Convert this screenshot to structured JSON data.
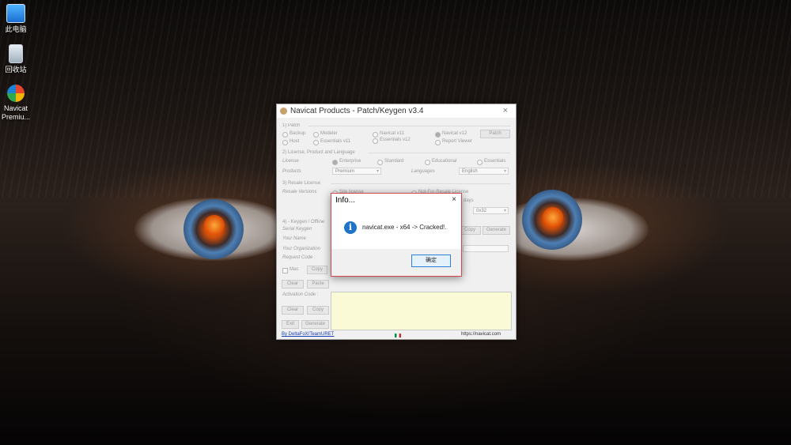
{
  "desktop": {
    "icons": [
      {
        "label": "此电脑",
        "icon": "computer-icon"
      },
      {
        "label": "回收站",
        "icon": "recycle-bin-icon"
      },
      {
        "label": "Navicat Premiu...",
        "icon": "navicat-icon"
      }
    ]
  },
  "patch_window": {
    "title": "Navicat Products - Patch/Keygen v3.4",
    "close_symbol": "×",
    "patch": {
      "heading": "1) Patch",
      "options": [
        "Backup",
        "Modeler",
        "Navicat v11",
        "Navicat v12",
        "Host",
        "Essentials v11",
        "Essentials v12",
        "Report Viewer"
      ],
      "patch_button": "Patch"
    },
    "license": {
      "heading": "2) License, Product and Language",
      "license_label": "License",
      "license_options": [
        "Enterprise",
        "Standard",
        "Educational",
        "Essentials"
      ],
      "products_label": "Products",
      "products_value": "Premium",
      "languages_label": "Languages",
      "languages_value": "English"
    },
    "resale": {
      "heading": "3) Resale License",
      "resale_versions_label": "Resale Versions",
      "site_license": "Site license",
      "not_for_resale": "Not-For-Resale License",
      "days_label": "days",
      "version_value": "0x32"
    },
    "keygen": {
      "heading": "4) - Keygen / Offline",
      "serial_label": "Serial Keygen",
      "name_label": "Your Name",
      "org_label": "Your Organization",
      "request_label": "Request Code :",
      "mac_label": "Mac",
      "copy_label": "Copy",
      "clear_label": "Clear",
      "paste_label": "Paste",
      "activation_label": "Activation Code :",
      "clear2_label": "Clear",
      "copy2_label": "Copy",
      "exit_label": "Exit",
      "generate_label": "Generate",
      "gen_top_label": "Generate",
      "copy_top_label": "Copy"
    },
    "footer": {
      "credit": "By DeltaFoX/TeamURET",
      "url": "https://navicat.com"
    }
  },
  "info_dialog": {
    "title": "Info...",
    "close_symbol": "×",
    "icon": "info-icon",
    "message": "navicat.exe - x64 ->  Cracked!.",
    "ok_label": "确定",
    "accent": "#d34a4a"
  }
}
